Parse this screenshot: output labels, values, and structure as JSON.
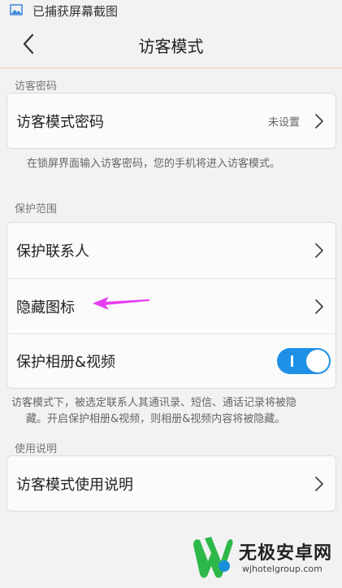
{
  "status_bar": {
    "text": "已捕获屏幕截图",
    "icon": "screenshot-icon"
  },
  "header": {
    "title": "访客模式",
    "back_icon": "chevron-left-icon"
  },
  "sections": {
    "password": {
      "label": "访客密码",
      "row": {
        "label": "访客模式密码",
        "value": "未设置"
      },
      "note": "在锁屏界面输入访客密码，您的手机将进入访客模式。"
    },
    "scope": {
      "label": "保护范围",
      "rows": [
        {
          "label": "保护联系人"
        },
        {
          "label": "隐藏图标"
        },
        {
          "label": "保护相册&视频",
          "toggle_on": true
        }
      ],
      "note_line1": "访客模式下，被选定联系人其通讯录、短信、通话记录将被隐",
      "note_line2": "藏。开启保护相册&视频，则相册&视频内容将被隐藏。"
    },
    "instructions": {
      "label": "使用说明",
      "row": {
        "label": "访客模式使用说明"
      }
    }
  },
  "annotation": {
    "color": "#e83cf0"
  },
  "watermark": {
    "name": "无极安卓网",
    "url": "wjhotelgroup.com",
    "color_primary": "#2fb84a",
    "color_secondary": "#1a8fd9"
  },
  "colors": {
    "accent": "#1e90e6",
    "background": "#f2f2f2"
  }
}
